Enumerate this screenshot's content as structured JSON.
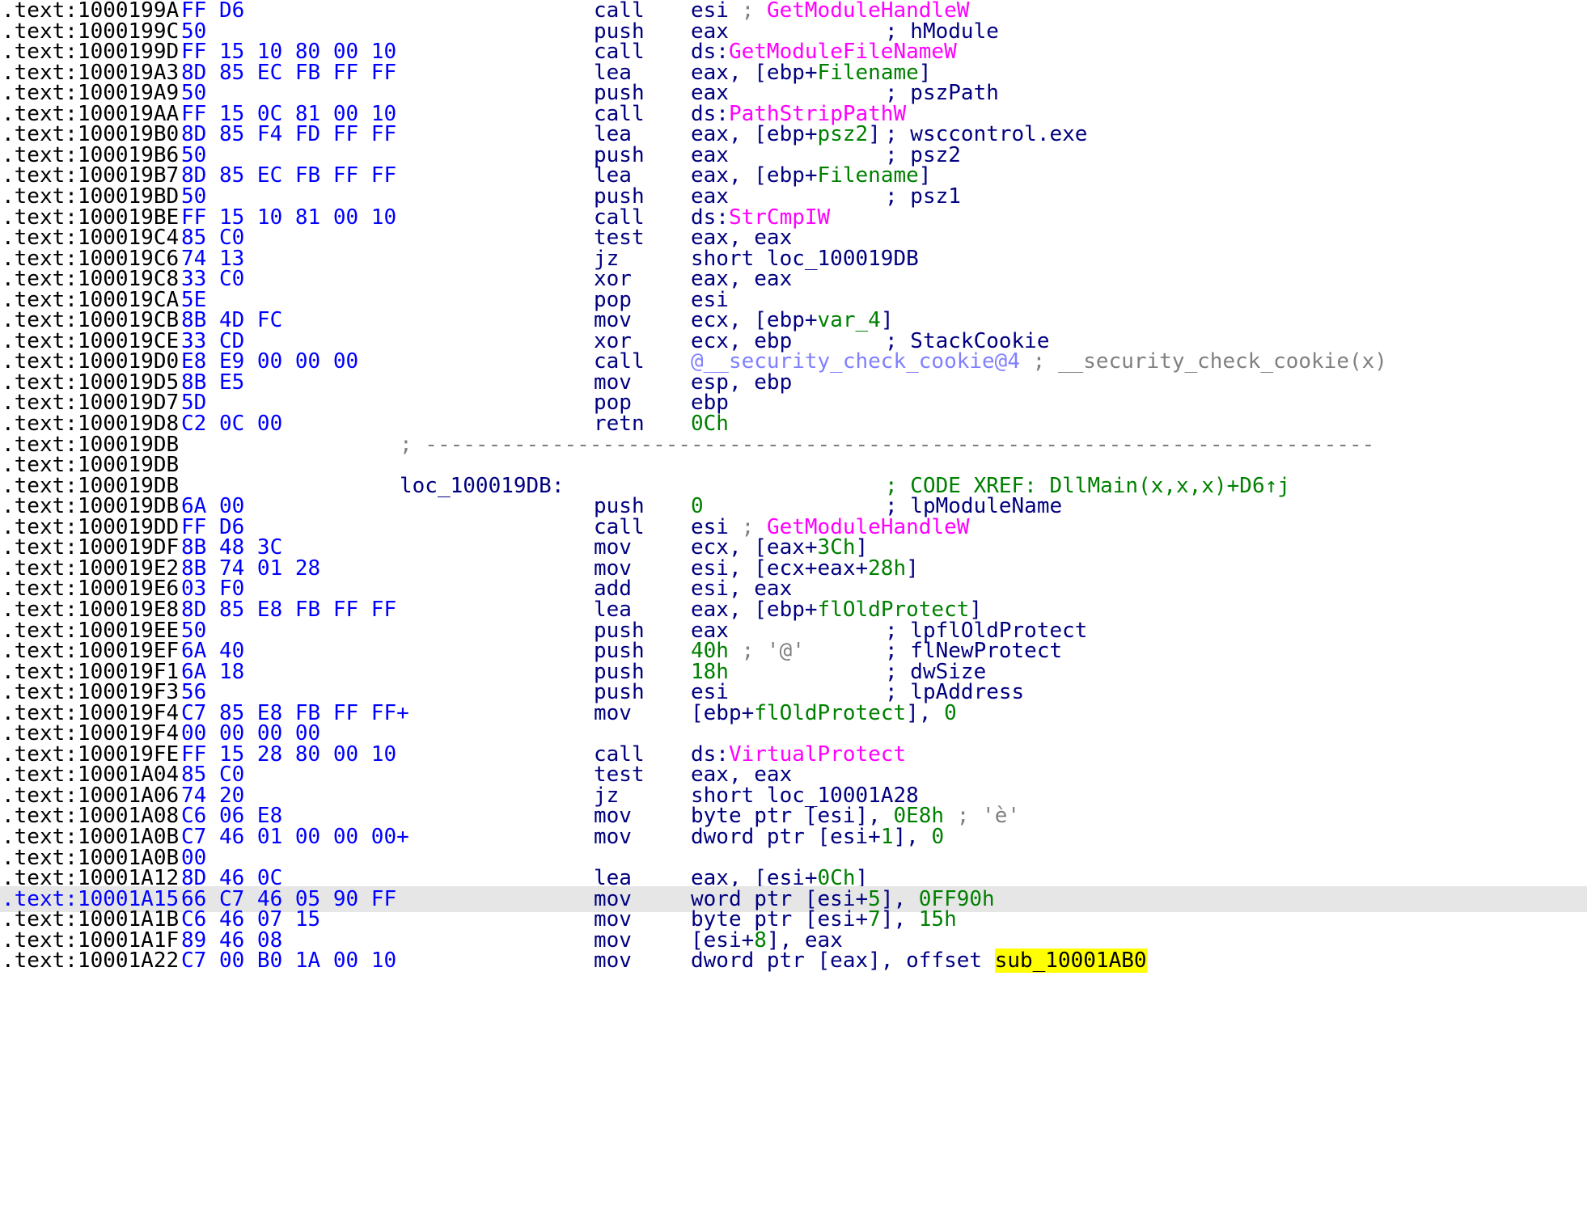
{
  "lines": [
    {
      "addr": ".text:1000199A",
      "bytes": "FF D6",
      "mnem": "call",
      "ops": [
        {
          "t": "esi",
          "c": "plain"
        },
        {
          "t": " ; ",
          "c": "gray"
        },
        {
          "t": "GetModuleHandleW",
          "c": "fn"
        }
      ]
    },
    {
      "addr": ".text:1000199C",
      "bytes": "50",
      "mnem": "push",
      "ops": [
        {
          "t": "eax",
          "c": "plain"
        }
      ],
      "comment": "; hModule"
    },
    {
      "addr": ".text:1000199D",
      "bytes": "FF 15 10 80 00 10",
      "mnem": "call",
      "ops": [
        {
          "t": "ds:",
          "c": "plain"
        },
        {
          "t": "GetModuleFileNameW",
          "c": "fn"
        }
      ]
    },
    {
      "addr": ".text:100019A3",
      "bytes": "8D 85 EC FB FF FF",
      "mnem": "lea",
      "ops": [
        {
          "t": "eax, [ebp+",
          "c": "plain"
        },
        {
          "t": "Filename",
          "c": "num"
        },
        {
          "t": "]",
          "c": "plain"
        }
      ]
    },
    {
      "addr": ".text:100019A9",
      "bytes": "50",
      "mnem": "push",
      "ops": [
        {
          "t": "eax",
          "c": "plain"
        }
      ],
      "comment": "; pszPath"
    },
    {
      "addr": ".text:100019AA",
      "bytes": "FF 15 0C 81 00 10",
      "mnem": "call",
      "ops": [
        {
          "t": "ds:",
          "c": "plain"
        },
        {
          "t": "PathStripPathW",
          "c": "fn"
        }
      ]
    },
    {
      "addr": ".text:100019B0",
      "bytes": "8D 85 F4 FD FF FF",
      "mnem": "lea",
      "ops": [
        {
          "t": "eax, [ebp+",
          "c": "plain"
        },
        {
          "t": "psz2",
          "c": "num"
        },
        {
          "t": "]",
          "c": "plain"
        }
      ],
      "comment": "; wsccontrol.exe"
    },
    {
      "addr": ".text:100019B6",
      "bytes": "50",
      "mnem": "push",
      "ops": [
        {
          "t": "eax",
          "c": "plain"
        }
      ],
      "comment": "; psz2"
    },
    {
      "addr": ".text:100019B7",
      "bytes": "8D 85 EC FB FF FF",
      "mnem": "lea",
      "ops": [
        {
          "t": "eax, [ebp+",
          "c": "plain"
        },
        {
          "t": "Filename",
          "c": "num"
        },
        {
          "t": "]",
          "c": "plain"
        }
      ]
    },
    {
      "addr": ".text:100019BD",
      "bytes": "50",
      "mnem": "push",
      "ops": [
        {
          "t": "eax",
          "c": "plain"
        }
      ],
      "comment": "; psz1"
    },
    {
      "addr": ".text:100019BE",
      "bytes": "FF 15 10 81 00 10",
      "mnem": "call",
      "ops": [
        {
          "t": "ds:",
          "c": "plain"
        },
        {
          "t": "StrCmpIW",
          "c": "fn"
        }
      ]
    },
    {
      "addr": ".text:100019C4",
      "bytes": "85 C0",
      "mnem": "test",
      "ops": [
        {
          "t": "eax, eax",
          "c": "plain"
        }
      ]
    },
    {
      "addr": ".text:100019C6",
      "bytes": "74 13",
      "mnem": "jz",
      "ops": [
        {
          "t": "short loc_100019DB",
          "c": "plain"
        }
      ]
    },
    {
      "addr": ".text:100019C8",
      "bytes": "33 C0",
      "mnem": "xor",
      "ops": [
        {
          "t": "eax, eax",
          "c": "plain"
        }
      ]
    },
    {
      "addr": ".text:100019CA",
      "bytes": "5E",
      "mnem": "pop",
      "ops": [
        {
          "t": "esi",
          "c": "plain"
        }
      ]
    },
    {
      "addr": ".text:100019CB",
      "bytes": "8B 4D FC",
      "mnem": "mov",
      "ops": [
        {
          "t": "ecx, [ebp+",
          "c": "plain"
        },
        {
          "t": "var_4",
          "c": "num"
        },
        {
          "t": "]",
          "c": "plain"
        }
      ]
    },
    {
      "addr": ".text:100019CE",
      "bytes": "33 CD",
      "mnem": "xor",
      "ops": [
        {
          "t": "ecx, ebp",
          "c": "plain"
        }
      ],
      "comment": "; StackCookie"
    },
    {
      "addr": ".text:100019D0",
      "bytes": "E8 E9 00 00 00",
      "mnem": "call",
      "ops": [
        {
          "t": "@__security_check_cookie@4",
          "c": "lib"
        },
        {
          "t": " ; __security_check_cookie(x)",
          "c": "gray"
        }
      ]
    },
    {
      "addr": ".text:100019D5",
      "bytes": "8B E5",
      "mnem": "mov",
      "ops": [
        {
          "t": "esp, ebp",
          "c": "plain"
        }
      ]
    },
    {
      "addr": ".text:100019D7",
      "bytes": "5D",
      "mnem": "pop",
      "ops": [
        {
          "t": "ebp",
          "c": "plain"
        }
      ]
    },
    {
      "addr": ".text:100019D8",
      "bytes": "C2 0C 00",
      "mnem": "retn",
      "ops": [
        {
          "t": "0Ch",
          "c": "num"
        }
      ]
    },
    {
      "addr": ".text:100019DB",
      "separator": "; ---------------------------------------------------------------------------"
    },
    {
      "addr": ".text:100019DB"
    },
    {
      "addr": ".text:100019DB",
      "label": "loc_100019DB:",
      "xref": "; CODE XREF: DllMain(x,x,x)+D6↑j"
    },
    {
      "addr": ".text:100019DB",
      "bytes": "6A 00",
      "mnem": "push",
      "ops": [
        {
          "t": "0",
          "c": "num"
        }
      ],
      "comment": "; lpModuleName"
    },
    {
      "addr": ".text:100019DD",
      "bytes": "FF D6",
      "mnem": "call",
      "ops": [
        {
          "t": "esi",
          "c": "plain"
        },
        {
          "t": " ; ",
          "c": "gray"
        },
        {
          "t": "GetModuleHandleW",
          "c": "fn"
        }
      ]
    },
    {
      "addr": ".text:100019DF",
      "bytes": "8B 48 3C",
      "mnem": "mov",
      "ops": [
        {
          "t": "ecx, [eax+",
          "c": "plain"
        },
        {
          "t": "3Ch",
          "c": "num"
        },
        {
          "t": "]",
          "c": "plain"
        }
      ]
    },
    {
      "addr": ".text:100019E2",
      "bytes": "8B 74 01 28",
      "mnem": "mov",
      "ops": [
        {
          "t": "esi, [ecx+eax+",
          "c": "plain"
        },
        {
          "t": "28h",
          "c": "num"
        },
        {
          "t": "]",
          "c": "plain"
        }
      ]
    },
    {
      "addr": ".text:100019E6",
      "bytes": "03 F0",
      "mnem": "add",
      "ops": [
        {
          "t": "esi, eax",
          "c": "plain"
        }
      ]
    },
    {
      "addr": ".text:100019E8",
      "bytes": "8D 85 E8 FB FF FF",
      "mnem": "lea",
      "ops": [
        {
          "t": "eax, [ebp+",
          "c": "plain"
        },
        {
          "t": "flOldProtect",
          "c": "num"
        },
        {
          "t": "]",
          "c": "plain"
        }
      ]
    },
    {
      "addr": ".text:100019EE",
      "bytes": "50",
      "mnem": "push",
      "ops": [
        {
          "t": "eax",
          "c": "plain"
        }
      ],
      "comment": "; lpflOldProtect"
    },
    {
      "addr": ".text:100019EF",
      "bytes": "6A 40",
      "mnem": "push",
      "ops": [
        {
          "t": "40h",
          "c": "num"
        },
        {
          "t": " ; '@'",
          "c": "gray"
        }
      ],
      "comment": "; flNewProtect"
    },
    {
      "addr": ".text:100019F1",
      "bytes": "6A 18",
      "mnem": "push",
      "ops": [
        {
          "t": "18h",
          "c": "num"
        }
      ],
      "comment": "; dwSize"
    },
    {
      "addr": ".text:100019F3",
      "bytes": "56",
      "mnem": "push",
      "ops": [
        {
          "t": "esi",
          "c": "plain"
        }
      ],
      "comment": "; lpAddress"
    },
    {
      "addr": ".text:100019F4",
      "bytes": "C7 85 E8 FB FF FF+",
      "mnem": "mov",
      "ops": [
        {
          "t": "[ebp+",
          "c": "plain"
        },
        {
          "t": "flOldProtect",
          "c": "num"
        },
        {
          "t": "], ",
          "c": "plain"
        },
        {
          "t": "0",
          "c": "num"
        }
      ]
    },
    {
      "addr": ".text:100019F4",
      "bytes": "00 00 00 00"
    },
    {
      "addr": ".text:100019FE",
      "bytes": "FF 15 28 80 00 10",
      "mnem": "call",
      "ops": [
        {
          "t": "ds:",
          "c": "plain"
        },
        {
          "t": "VirtualProtect",
          "c": "fn"
        }
      ]
    },
    {
      "addr": ".text:10001A04",
      "bytes": "85 C0",
      "mnem": "test",
      "ops": [
        {
          "t": "eax, eax",
          "c": "plain"
        }
      ]
    },
    {
      "addr": ".text:10001A06",
      "bytes": "74 20",
      "mnem": "jz",
      "ops": [
        {
          "t": "short loc_10001A28",
          "c": "plain"
        }
      ]
    },
    {
      "addr": ".text:10001A08",
      "bytes": "C6 06 E8",
      "mnem": "mov",
      "ops": [
        {
          "t": "byte ptr [esi], ",
          "c": "plain"
        },
        {
          "t": "0E8h",
          "c": "num"
        },
        {
          "t": " ; 'è'",
          "c": "gray"
        }
      ]
    },
    {
      "addr": ".text:10001A0B",
      "bytes": "C7 46 01 00 00 00+",
      "mnem": "mov",
      "ops": [
        {
          "t": "dword ptr [esi+",
          "c": "plain"
        },
        {
          "t": "1",
          "c": "num"
        },
        {
          "t": "], ",
          "c": "plain"
        },
        {
          "t": "0",
          "c": "num"
        }
      ]
    },
    {
      "addr": ".text:10001A0B",
      "bytes": "00"
    },
    {
      "addr": ".text:10001A12",
      "bytes": "8D 46 0C",
      "mnem": "lea",
      "ops": [
        {
          "t": "eax, [esi+",
          "c": "plain"
        },
        {
          "t": "0Ch",
          "c": "num"
        },
        {
          "t": "]",
          "c": "plain"
        }
      ]
    },
    {
      "addr": ".text:10001A15",
      "bytes": "66 C7 46 05 90 FF",
      "mnem": "mov",
      "ops": [
        {
          "t": "word ptr [esi+",
          "c": "plain"
        },
        {
          "t": "5",
          "c": "num"
        },
        {
          "t": "], ",
          "c": "plain"
        },
        {
          "t": "0FF90h",
          "c": "num"
        }
      ],
      "highlight": true
    },
    {
      "addr": ".text:10001A1B",
      "bytes": "C6 46 07 15",
      "mnem": "mov",
      "ops": [
        {
          "t": "byte ptr [esi+",
          "c": "plain"
        },
        {
          "t": "7",
          "c": "num"
        },
        {
          "t": "], ",
          "c": "plain"
        },
        {
          "t": "15h",
          "c": "num"
        }
      ]
    },
    {
      "addr": ".text:10001A1F",
      "bytes": "89 46 08",
      "mnem": "mov",
      "ops": [
        {
          "t": "[esi+",
          "c": "plain"
        },
        {
          "t": "8",
          "c": "num"
        },
        {
          "t": "], eax",
          "c": "plain"
        }
      ]
    },
    {
      "addr": ".text:10001A22",
      "bytes": "C7 00 B0 1A 00 10",
      "mnem": "mov",
      "ops": [
        {
          "t": "dword ptr [eax], offset ",
          "c": "plain"
        },
        {
          "t": "sub_10001AB0",
          "c": "hl"
        }
      ]
    }
  ],
  "colors": {
    "address": "#000000",
    "bytes": "#0000ff",
    "mnemonic": "#000080",
    "function": "#ff00ff",
    "number": "#008000",
    "comment_gray": "#808080",
    "library": "#8080ff",
    "highlight_row": "#e6e6e6",
    "highlight_name": "#ffff00"
  }
}
